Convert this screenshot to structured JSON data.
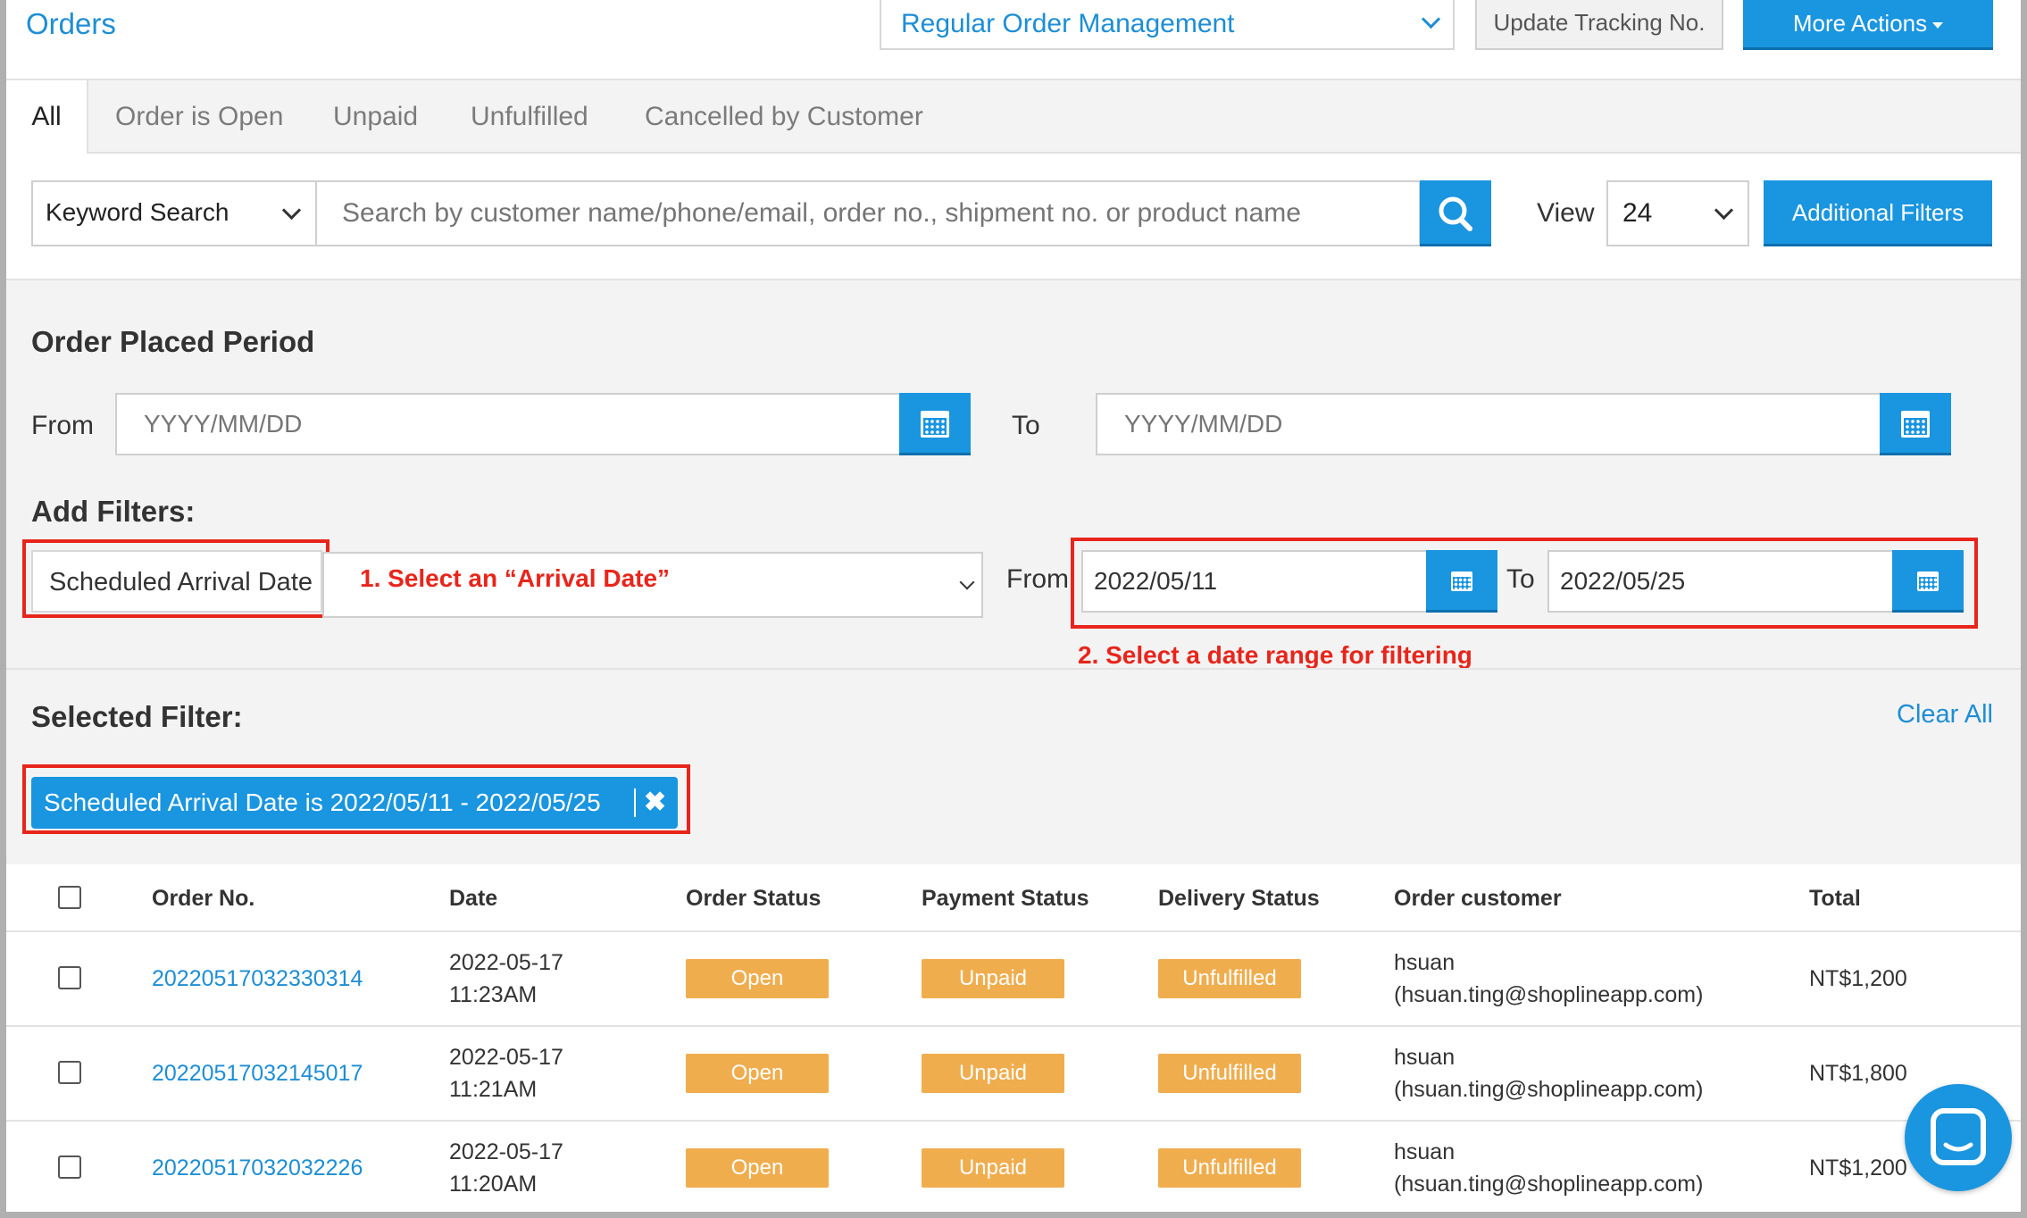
{
  "header": {
    "title": "Orders",
    "management_select": "Regular Order Management",
    "update_tracking": "Update Tracking No.",
    "more_actions": "More Actions"
  },
  "tabs": [
    "All",
    "Order is Open",
    "Unpaid",
    "Unfulfilled",
    "Cancelled by Customer"
  ],
  "search": {
    "type": "Keyword Search",
    "placeholder": "Search by customer name/phone/email, order no., shipment no. or product name",
    "view_label": "View",
    "view_value": "24",
    "additional_filters": "Additional Filters"
  },
  "period": {
    "title": "Order Placed Period",
    "from_label": "From",
    "to_label": "To",
    "placeholder": "YYYY/MM/DD"
  },
  "filters": {
    "title": "Add Filters:",
    "type": "Scheduled Arrival Date",
    "annotation_1": "1. Select an “Arrival Date”",
    "from_label": "From",
    "to_label": "To",
    "from_value": "2022/05/11",
    "to_value": "2022/05/25",
    "annotation_2": "2. Select a date range for filtering"
  },
  "selected": {
    "title": "Selected Filter:",
    "clear_all": "Clear All",
    "pill": "Scheduled Arrival Date is 2022/05/11 - 2022/05/25"
  },
  "table": {
    "headers": [
      "Order No.",
      "Date",
      "Order Status",
      "Payment Status",
      "Delivery Status",
      "Order customer",
      "Total"
    ],
    "rows": [
      {
        "order_no": "20220517032330314",
        "date": "2022-05-17",
        "time": "11:23AM",
        "order_status": "Open",
        "payment_status": "Unpaid",
        "delivery_status": "Unfulfilled",
        "customer": "hsuan",
        "email": "(hsuan.ting@shoplineapp.com)",
        "total": "NT$1,200"
      },
      {
        "order_no": "20220517032145017",
        "date": "2022-05-17",
        "time": "11:21AM",
        "order_status": "Open",
        "payment_status": "Unpaid",
        "delivery_status": "Unfulfilled",
        "customer": "hsuan",
        "email": "(hsuan.ting@shoplineapp.com)",
        "total": "NT$1,800"
      },
      {
        "order_no": "20220517032032226",
        "date": "2022-05-17",
        "time": "11:20AM",
        "order_status": "Open",
        "payment_status": "Unpaid",
        "delivery_status": "Unfulfilled",
        "customer": "hsuan",
        "email": "(hsuan.ting@shoplineapp.com)",
        "total": "NT$1,200"
      }
    ]
  },
  "colors": {
    "accent": "#1a95e0",
    "link": "#1d8ed6",
    "badge": "#f0ad4e",
    "annotation": "#e8251b"
  }
}
